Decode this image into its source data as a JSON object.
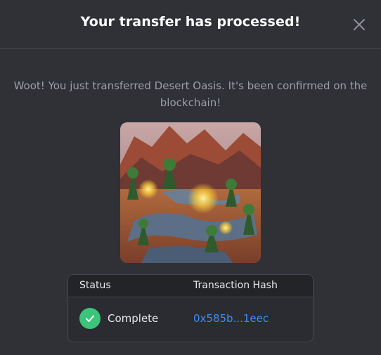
{
  "modal": {
    "title": "Your transfer has processed!",
    "close_icon": "close-icon",
    "message": "Woot! You just transferred Desert Oasis. It's been confirmed on the blockchain!"
  },
  "nft": {
    "image_icon": "desert-oasis-artwork"
  },
  "table": {
    "headers": {
      "status": "Status",
      "hash": "Transaction Hash"
    },
    "row": {
      "status_icon": "check-circle-icon",
      "status": "Complete",
      "hash": "0x585b...1eec"
    }
  },
  "colors": {
    "background": "#2f3136",
    "success": "#3cc47a",
    "link": "#3f8ef0"
  }
}
